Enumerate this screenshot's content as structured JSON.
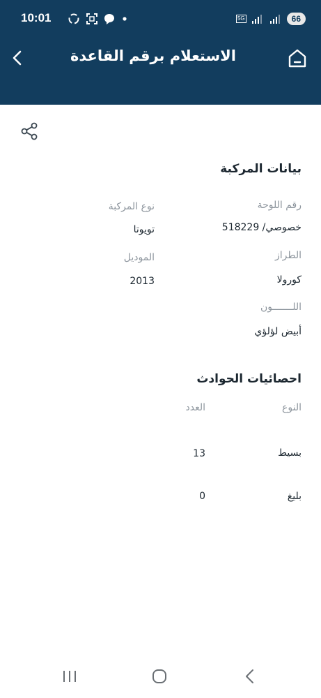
{
  "status_bar": {
    "time": "10:01",
    "battery": "66",
    "network": "5G"
  },
  "header": {
    "title": "الاستعلام برقم القاعدة"
  },
  "vehicle": {
    "section_title": "بيانات المركبة",
    "plate_label": "رقم اللوحة",
    "plate_value": "خصوصي/ 518229",
    "type_label": "نوع المركبة",
    "type_value": "تويوتا",
    "brand_label": "الطراز",
    "brand_value": "كورولا",
    "model_label": "الموديل",
    "model_value": "2013",
    "color_label": "اللـــــــون",
    "color_value": "أبيض لؤلؤي"
  },
  "accidents": {
    "section_title": "احصائيات الحوادث",
    "col_type": "النوع",
    "col_count": "العدد",
    "rows": [
      {
        "type": "بسيط",
        "count": "13"
      },
      {
        "type": "بليغ",
        "count": "0"
      }
    ]
  },
  "colors": {
    "header_bg": "#123d5e",
    "text_primary": "#1c2730",
    "text_label": "#8e969e"
  },
  "icons": [
    "chevron-left-icon",
    "home-icon",
    "share-icon",
    "recent-apps-icon",
    "nav-home-icon",
    "nav-back-icon"
  ]
}
